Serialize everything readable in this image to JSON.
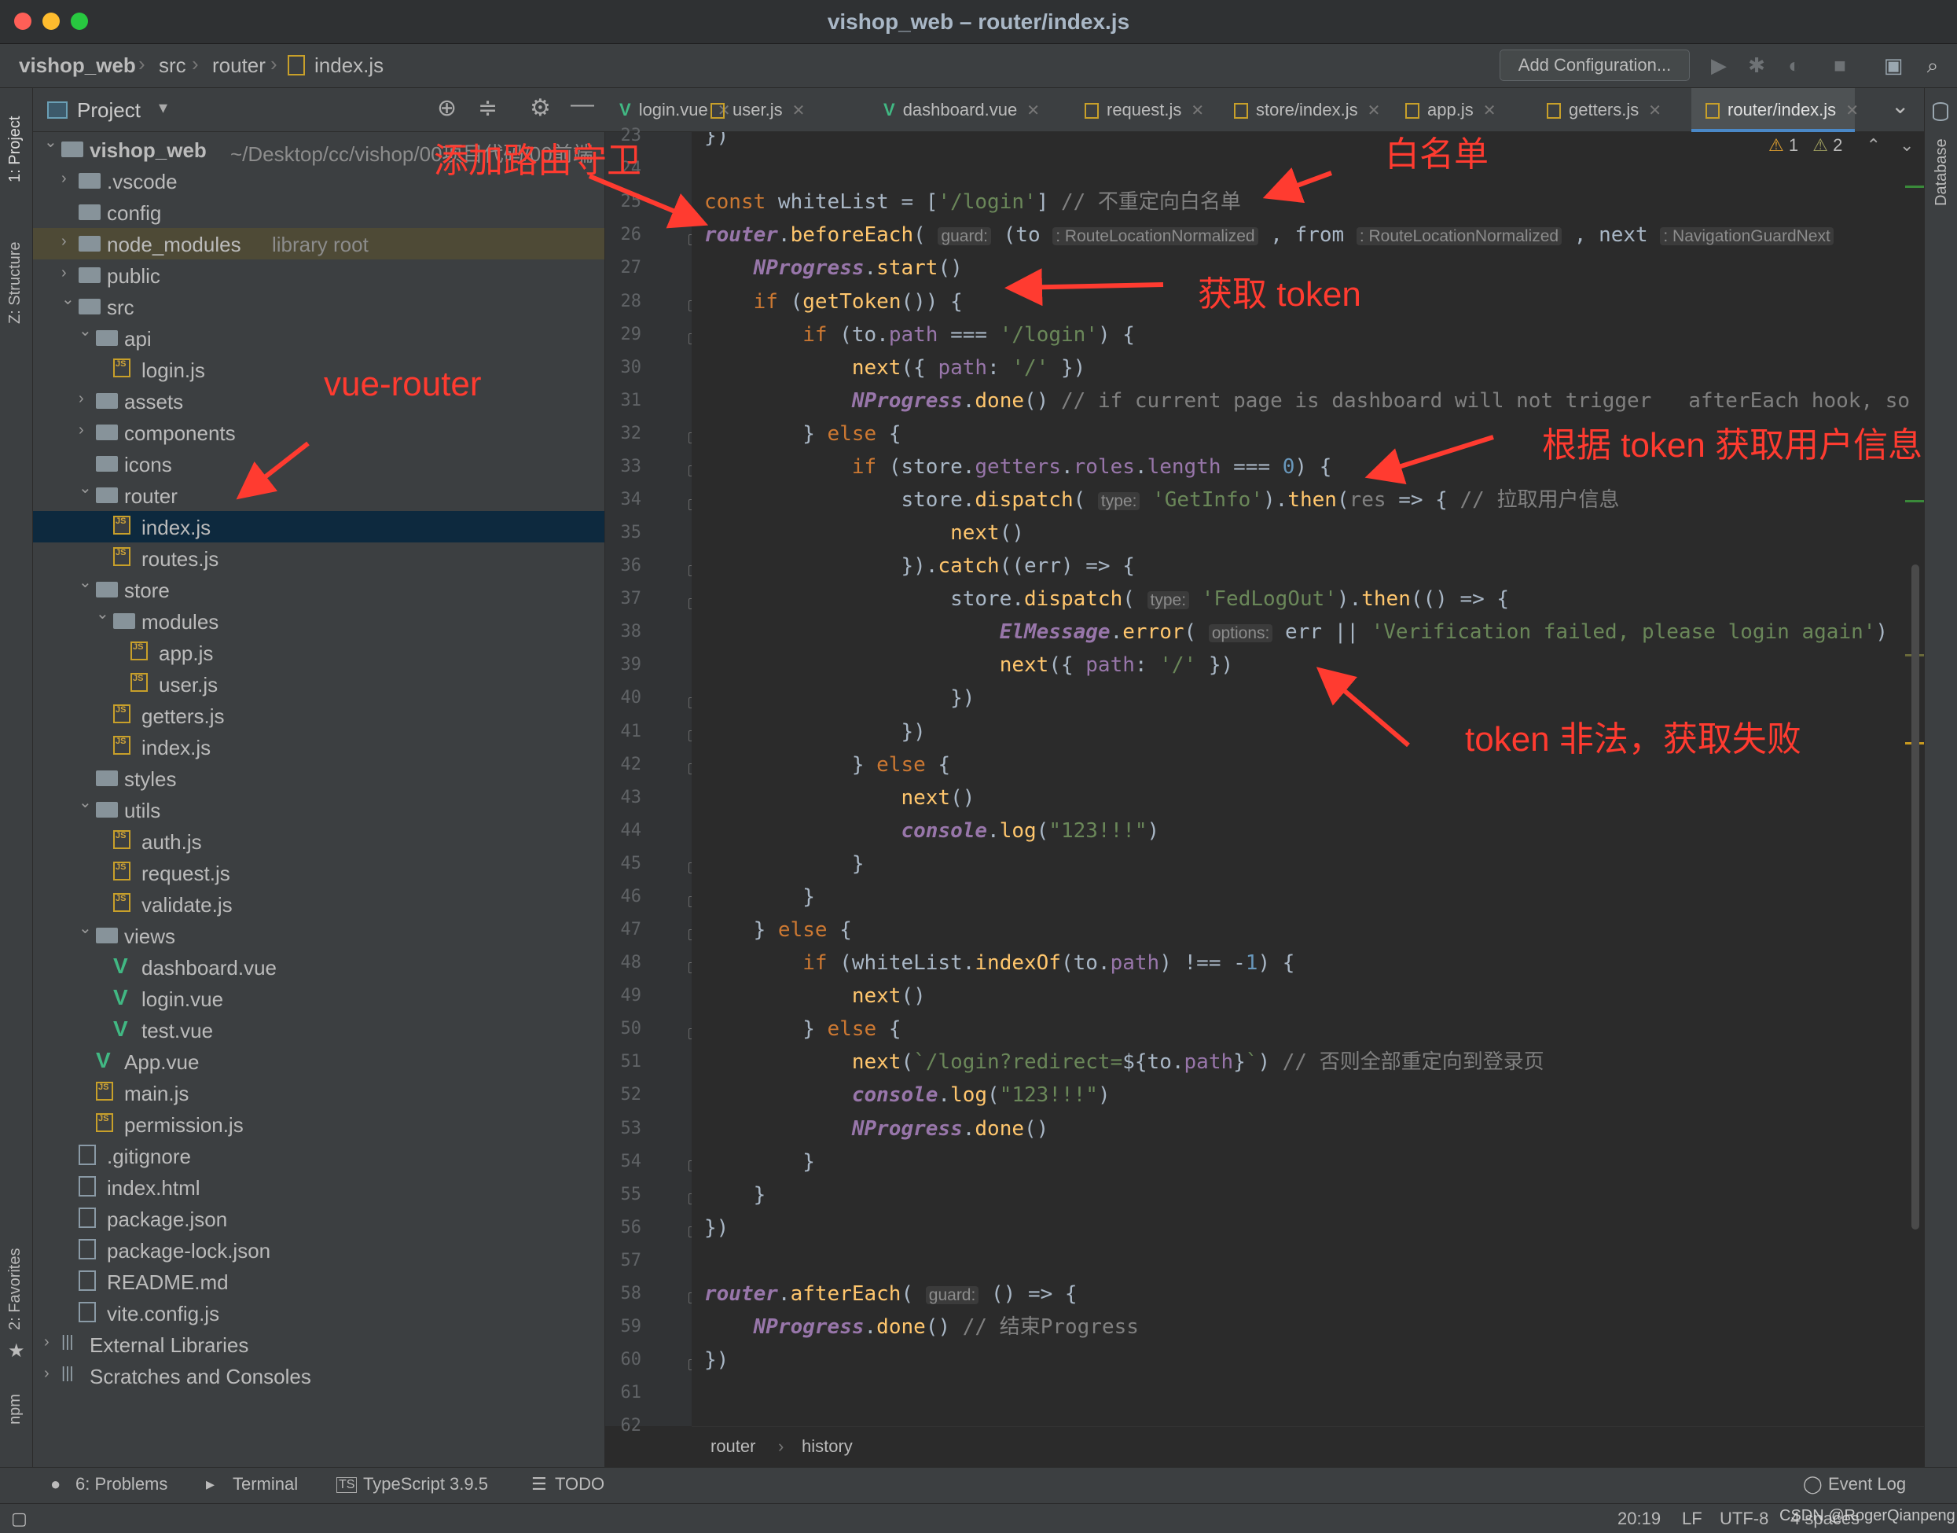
{
  "window": {
    "title": "vishop_web – router/index.js"
  },
  "breadcrumb": {
    "items": [
      "vishop_web",
      "src",
      "router",
      "index.js"
    ]
  },
  "toolbar": {
    "add_configuration": "Add Configuration..."
  },
  "side_tabs": {
    "project": "1: Project",
    "structure": "Z: Structure",
    "favorites": "2: Favorites",
    "npm": "npm",
    "database": "Database"
  },
  "project_panel": {
    "title": "Project"
  },
  "tree": [
    {
      "label": "vishop_web",
      "extra": "~/Desktop/cc/vishop/00项目代码/00前端",
      "kind": "folder",
      "level": 0,
      "arrow": "down",
      "bold": true
    },
    {
      "label": ".vscode",
      "kind": "folder",
      "level": 1,
      "arrow": "right"
    },
    {
      "label": "config",
      "kind": "folder",
      "level": 1,
      "arrow": ""
    },
    {
      "label": "node_modules",
      "extra": "library root",
      "kind": "folder",
      "level": 1,
      "arrow": "right",
      "highlight": true
    },
    {
      "label": "public",
      "kind": "folder",
      "level": 1,
      "arrow": "right"
    },
    {
      "label": "src",
      "kind": "folder",
      "level": 1,
      "arrow": "down"
    },
    {
      "label": "api",
      "kind": "folder",
      "level": 2,
      "arrow": "down"
    },
    {
      "label": "login.js",
      "kind": "js",
      "level": 3,
      "arrow": ""
    },
    {
      "label": "assets",
      "kind": "folder",
      "level": 2,
      "arrow": "right"
    },
    {
      "label": "components",
      "kind": "folder",
      "level": 2,
      "arrow": "right"
    },
    {
      "label": "icons",
      "kind": "folder",
      "level": 2,
      "arrow": ""
    },
    {
      "label": "router",
      "kind": "folder",
      "level": 2,
      "arrow": "down"
    },
    {
      "label": "index.js",
      "kind": "js",
      "level": 3,
      "arrow": "",
      "selected": true
    },
    {
      "label": "routes.js",
      "kind": "js",
      "level": 3,
      "arrow": ""
    },
    {
      "label": "store",
      "kind": "folder",
      "level": 2,
      "arrow": "down"
    },
    {
      "label": "modules",
      "kind": "folder",
      "level": 3,
      "arrow": "down"
    },
    {
      "label": "app.js",
      "kind": "js",
      "level": 4,
      "arrow": ""
    },
    {
      "label": "user.js",
      "kind": "js",
      "level": 4,
      "arrow": ""
    },
    {
      "label": "getters.js",
      "kind": "js",
      "level": 3,
      "arrow": ""
    },
    {
      "label": "index.js",
      "kind": "js",
      "level": 3,
      "arrow": ""
    },
    {
      "label": "styles",
      "kind": "folder",
      "level": 2,
      "arrow": ""
    },
    {
      "label": "utils",
      "kind": "folder",
      "level": 2,
      "arrow": "down"
    },
    {
      "label": "auth.js",
      "kind": "js",
      "level": 3,
      "arrow": ""
    },
    {
      "label": "request.js",
      "kind": "js",
      "level": 3,
      "arrow": ""
    },
    {
      "label": "validate.js",
      "kind": "js",
      "level": 3,
      "arrow": ""
    },
    {
      "label": "views",
      "kind": "folder",
      "level": 2,
      "arrow": "down"
    },
    {
      "label": "dashboard.vue",
      "kind": "vue",
      "level": 3,
      "arrow": ""
    },
    {
      "label": "login.vue",
      "kind": "vue",
      "level": 3,
      "arrow": ""
    },
    {
      "label": "test.vue",
      "kind": "vue",
      "level": 3,
      "arrow": ""
    },
    {
      "label": "App.vue",
      "kind": "vue",
      "level": 2,
      "arrow": ""
    },
    {
      "label": "main.js",
      "kind": "js",
      "level": 2,
      "arrow": ""
    },
    {
      "label": "permission.js",
      "kind": "js",
      "level": 2,
      "arrow": ""
    },
    {
      "label": ".gitignore",
      "kind": "file",
      "level": 1,
      "arrow": ""
    },
    {
      "label": "index.html",
      "kind": "file",
      "level": 1,
      "arrow": ""
    },
    {
      "label": "package.json",
      "kind": "file",
      "level": 1,
      "arrow": ""
    },
    {
      "label": "package-lock.json",
      "kind": "file",
      "level": 1,
      "arrow": ""
    },
    {
      "label": "README.md",
      "kind": "file",
      "level": 1,
      "arrow": ""
    },
    {
      "label": "vite.config.js",
      "kind": "file",
      "level": 1,
      "arrow": ""
    },
    {
      "label": "External Libraries",
      "kind": "lib",
      "level": 0,
      "arrow": "right"
    },
    {
      "label": "Scratches and Consoles",
      "kind": "lib",
      "level": 0,
      "arrow": "right"
    }
  ],
  "editor_tabs": [
    {
      "label": "login.vue",
      "kind": "vue"
    },
    {
      "label": "user.js",
      "kind": "js"
    },
    {
      "label": "dashboard.vue",
      "kind": "vue"
    },
    {
      "label": "request.js",
      "kind": "js"
    },
    {
      "label": "store/index.js",
      "kind": "js"
    },
    {
      "label": "app.js",
      "kind": "js"
    },
    {
      "label": "getters.js",
      "kind": "js"
    },
    {
      "label": "router/index.js",
      "kind": "js",
      "active": true
    }
  ],
  "inspections": {
    "warnings": "1",
    "weak_warnings": "2"
  },
  "code_lines": [
    {
      "n": "23",
      "html": "<span>})</span>"
    },
    {
      "n": "24",
      "html": ""
    },
    {
      "n": "25",
      "html": "<span class='kw'>const </span>whiteList = [<span class='st'>'/login'</span>] <span class='cm'>// 不重定向白名单</span>"
    },
    {
      "n": "26",
      "html": "<span class='gl'>router</span>.<span class='fn'>beforeEach</span>( <span class='hint'>guard:</span> (to <span class='hint'>: RouteLocationNormalized</span> , from <span class='hint'>: RouteLocationNormalized</span> , next <span class='hint'>: NavigationGuardNext</span>"
    },
    {
      "n": "27",
      "html": "    <span class='gl'>NProgress</span>.<span class='fn'>start</span>()"
    },
    {
      "n": "28",
      "html": "    <span class='kw'>if </span>(<span class='fn'>getToken</span>()) {"
    },
    {
      "n": "29",
      "html": "        <span class='kw'>if </span>(to.<span class='pr'>path</span> === <span class='st'>'/login'</span>) {"
    },
    {
      "n": "30",
      "html": "            <span class='fn'>next</span>({ <span class='pr'>path</span>: <span class='st'>'/'</span> })"
    },
    {
      "n": "31",
      "html": "            <span class='gl'>NProgress</span>.<span class='fn'>done</span>() <span class='cm'>// if current page is dashboard will not trigger   afterEach hook, so</span>"
    },
    {
      "n": "32",
      "html": "        } <span class='kw'>else </span>{"
    },
    {
      "n": "33",
      "html": "            <span class='kw'>if </span>(store.<span class='pr'>getters</span>.<span class='pr'>roles</span>.<span class='pr'>length</span> === <span class='nu'>0</span>) {"
    },
    {
      "n": "34",
      "html": "                store.<span class='fn'>dispatch</span>( <span class='hint'>type:</span> <span class='st'>'GetInfo'</span>).<span class='fn'>then</span>(<span class='cm'>res</span> => { <span class='cm'>// 拉取用户信息</span>"
    },
    {
      "n": "35",
      "html": "                    <span class='fn'>next</span>()"
    },
    {
      "n": "36",
      "html": "                }).<span class='fn'>catch</span>((err) => {"
    },
    {
      "n": "37",
      "html": "                    store.<span class='fn'>dispatch</span>( <span class='hint'>type:</span> <span class='st'>'FedLogOut'</span>).<span class='fn'>then</span>(() => {"
    },
    {
      "n": "38",
      "html": "                        <span class='gl'>ElMessage</span>.<span class='fn'>error</span>( <span class='hint'>options:</span> err || <span class='st'>'Verification failed, please login again'</span>)"
    },
    {
      "n": "39",
      "html": "                        <span class='fn'>next</span>({ <span class='pr'>path</span>: <span class='st'>'/'</span> })"
    },
    {
      "n": "40",
      "html": "                    })"
    },
    {
      "n": "41",
      "html": "                })"
    },
    {
      "n": "42",
      "html": "            } <span class='kw'>else </span>{"
    },
    {
      "n": "43",
      "html": "                <span class='fn'>next</span>()"
    },
    {
      "n": "44",
      "html": "                <span class='gl'>console</span>.<span class='fn'>log</span>(<span class='st'>\"123!!!\"</span>)"
    },
    {
      "n": "45",
      "html": "            }"
    },
    {
      "n": "46",
      "html": "        }"
    },
    {
      "n": "47",
      "html": "    } <span class='kw'>else </span>{"
    },
    {
      "n": "48",
      "html": "        <span class='kw'>if </span>(whiteList.<span class='fn'>indexOf</span>(to.<span class='pr'>path</span>) !== -<span class='nu'>1</span>) {"
    },
    {
      "n": "49",
      "html": "            <span class='fn'>next</span>()"
    },
    {
      "n": "50",
      "html": "        } <span class='kw'>else </span>{"
    },
    {
      "n": "51",
      "html": "            <span class='fn'>next</span>(<span class='st'>`/login?redirect=</span>${to.<span class='pr'>path</span>}<span class='st'>`</span>) <span class='cm'>// 否则全部重定向到登录页</span>"
    },
    {
      "n": "52",
      "html": "            <span class='gl'>console</span>.<span class='fn'>log</span>(<span class='st'>\"123!!!\"</span>)"
    },
    {
      "n": "53",
      "html": "            <span class='gl'>NProgress</span>.<span class='fn'>done</span>()"
    },
    {
      "n": "54",
      "html": "        }"
    },
    {
      "n": "55",
      "html": "    }"
    },
    {
      "n": "56",
      "html": "})"
    },
    {
      "n": "57",
      "html": ""
    },
    {
      "n": "58",
      "html": "<span class='gl'>router</span>.<span class='fn'>afterEach</span>( <span class='hint'>guard:</span> () => {"
    },
    {
      "n": "59",
      "html": "    <span class='gl'>NProgress</span>.<span class='fn'>done</span>() <span class='cm'>// 结束Progress</span>"
    },
    {
      "n": "60",
      "html": "})"
    },
    {
      "n": "61",
      "html": ""
    },
    {
      "n": "62",
      "html": ""
    }
  ],
  "code_breadcrumb": {
    "items": [
      "router",
      "history"
    ]
  },
  "bottom_tools": {
    "problems": "6: Problems",
    "terminal": "Terminal",
    "typescript": "TypeScript 3.9.5",
    "todo": "TODO",
    "event_log": "Event Log"
  },
  "status": {
    "position": "20:19",
    "line_sep": "LF",
    "encoding": "UTF-8",
    "indent": "4 spaces",
    "watermark": "CSDN @RogerQianpeng"
  },
  "annotations": {
    "add_guard": "添加路由守卫",
    "whitelist": "白名单",
    "get_token": "获取 token",
    "vue_router": "vue-router",
    "get_user_info": "根据 token 获取用户信息",
    "token_invalid": "token 非法，获取失败"
  },
  "colors": {
    "annotation": "#ff3b30",
    "selection": "#0d293e",
    "accent": "#4a88c7"
  }
}
